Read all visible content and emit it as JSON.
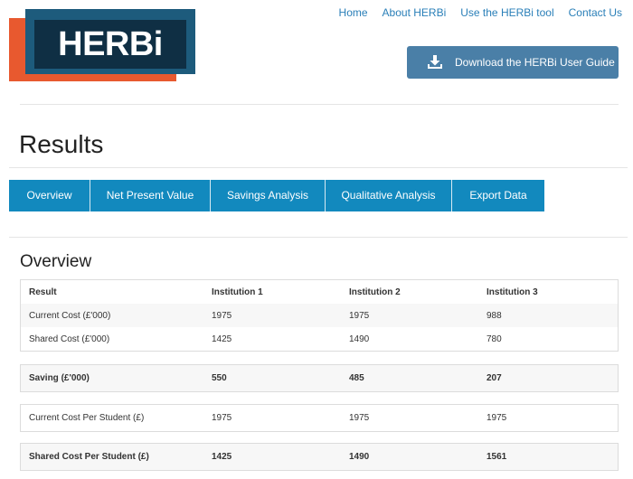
{
  "logo": {
    "text": "HERBi"
  },
  "nav": {
    "items": [
      "Home",
      "About HERBi",
      "Use the HERBi tool",
      "Contact Us"
    ]
  },
  "download_button": {
    "label": "Download the HERBi User Guide",
    "icon": "download-icon"
  },
  "page_title": "Results",
  "tabs": [
    "Overview",
    "Net Present Value",
    "Savings Analysis",
    "Qualitative Analysis",
    "Export Data"
  ],
  "section_title": "Overview",
  "table": {
    "headers": [
      "Result",
      "Institution 1",
      "Institution 2",
      "Institution 3"
    ],
    "current_cost": [
      "Current Cost (£'000)",
      "1975",
      "1975",
      "988"
    ],
    "shared_cost": [
      "Shared Cost (£'000)",
      "1425",
      "1490",
      "780"
    ],
    "saving": [
      "Saving (£'000)",
      "550",
      "485",
      "207"
    ],
    "current_cost_per_student": [
      "Current Cost Per Student (£)",
      "1975",
      "1975",
      "1975"
    ],
    "shared_cost_per_student": [
      "Shared Cost Per Student (£)",
      "1425",
      "1490",
      "1561"
    ]
  },
  "colors": {
    "accent": "#1289be",
    "button": "#4a7fa7",
    "link": "#2a7fb8",
    "logo_orange": "#e8592f",
    "logo_blue": "#1d5b7c",
    "logo_dark": "#0f2f44"
  }
}
